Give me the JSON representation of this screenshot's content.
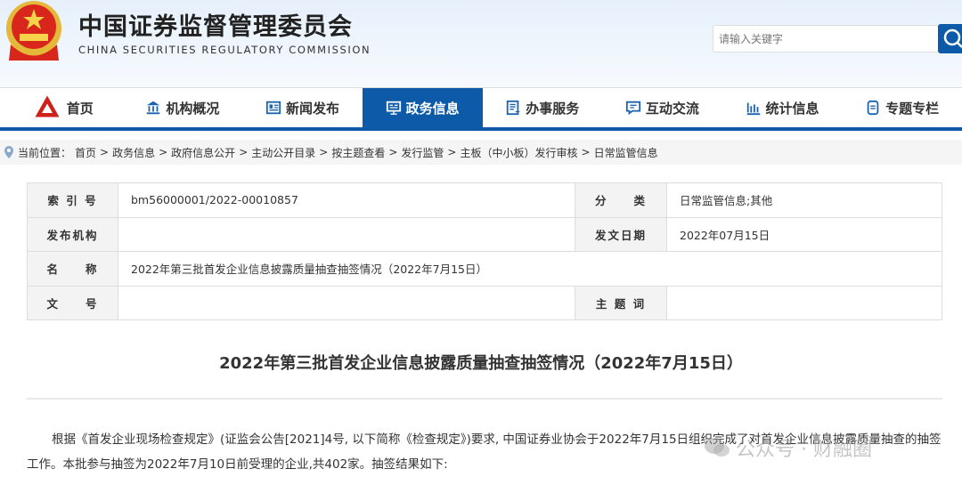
{
  "header": {
    "title_cn": "中国证券监督管理委员会",
    "title_en": "CHINA SECURITIES REGULATORY COMMISSION",
    "search_placeholder": "请输入关键字"
  },
  "nav": [
    "首页",
    "机构概况",
    "新闻发布",
    "政务信息",
    "办事服务",
    "互动交流",
    "统计信息",
    "专题专栏"
  ],
  "breadcrumb": {
    "label": "当前位置：",
    "items": [
      "首页",
      "政务信息",
      "政府信息公开",
      "主动公开目录",
      "按主题查看",
      "发行监管",
      "主板（中小板）发行审核",
      "日常监管信息"
    ]
  },
  "meta": {
    "index_label": "索 引 号",
    "index_value": "bm56000001/2022-00010857",
    "category_label": "分　　类",
    "category_value": "日常监管信息;其他",
    "issuer_label": "发布机构",
    "issuer_value": "",
    "date_label": "发文日期",
    "date_value": "2022年07月15日",
    "name_label": "名　　称",
    "name_value": "2022年第三批首发企业信息披露质量抽查抽签情况（2022年7月15日）",
    "docno_label": "文　　号",
    "docno_value": "",
    "keywords_label": "主 题 词",
    "keywords_value": ""
  },
  "article": {
    "title": "2022年第三批首发企业信息披露质量抽查抽签情况（2022年7月15日）",
    "body": "根据《首发企业现场检查规定》(证监会公告[2021]4号, 以下简称《检查规定》)要求, 中国证券业协会于2022年7月15日组织完成了对首发企业信息披露质量抽查的抽签工作。本批参与抽签为2022年7月10日前受理的企业,共402家。抽签结果如下:"
  },
  "watermark": "公众号 · 财融圈"
}
